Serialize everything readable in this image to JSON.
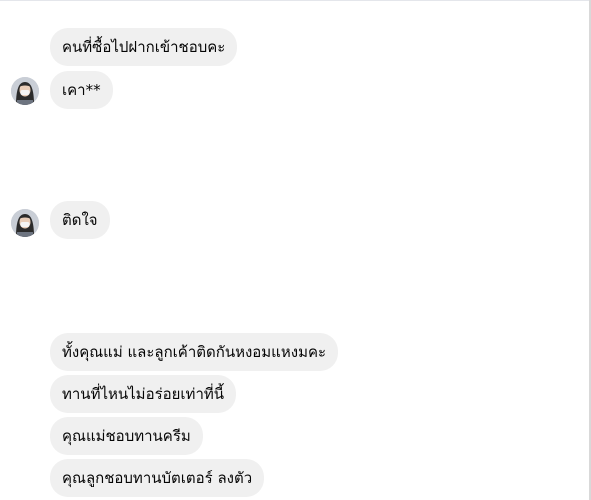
{
  "conversation": {
    "groups": [
      {
        "messages": [
          "คนที่ซื้อไปฝากเข้าชอบคะ",
          "เคา**"
        ]
      },
      {
        "messages": [
          "ติดใจ"
        ]
      },
      {
        "messages": [
          "ทั้งคุณแม่ และลูกเค้าติดกันหงอมแหงมคะ",
          "ทานที่ไหนไม่อร่อยเท่าที่นี้",
          "คุณแม่ชอบทานครีม",
          "คุณลูกชอบทานบัตเตอร์ ลงตัว"
        ]
      }
    ]
  },
  "colors": {
    "bubble_bg": "#f0f0f0",
    "text": "#050505",
    "divider": "#e4e6eb"
  }
}
